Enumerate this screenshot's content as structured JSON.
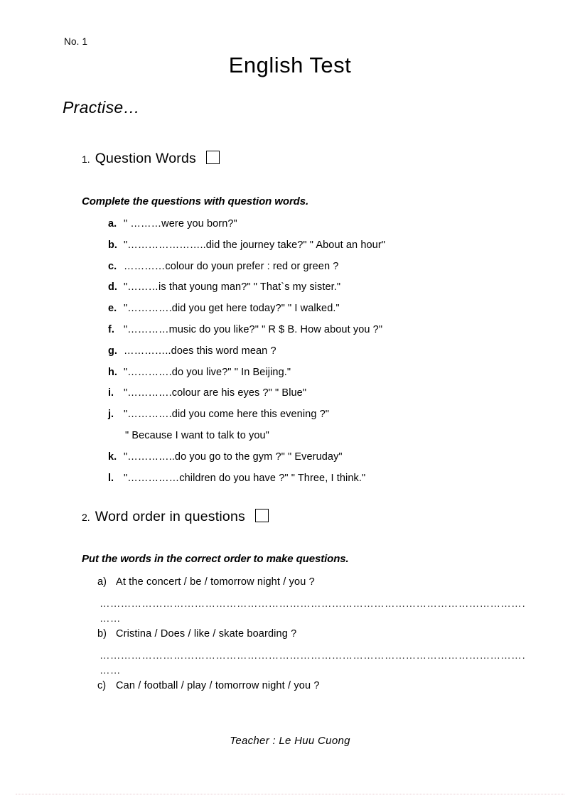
{
  "document": {
    "page_number_label": "No. 1",
    "title": "English Test",
    "subtitle": "Practise…",
    "footer": "Teacher : Le Huu Cuong"
  },
  "sections": [
    {
      "number": "1.",
      "title": "Question Words",
      "checkbox": "empty-checkbox",
      "instruction": "Complete the questions with question words.",
      "items": [
        {
          "marker": "a.",
          "text": "\" ………were you born?\""
        },
        {
          "marker": "b.",
          "text": "\"…………………..did the journey take?\" \" About an hour\""
        },
        {
          "marker": "c.",
          "text": "…………colour do youn prefer : red or green ?"
        },
        {
          "marker": "d.",
          "text": "\"………is that young man?\" \" That`s my sister.\""
        },
        {
          "marker": "e.",
          "text": "\"………….did you get here today?\" \" I walked.\""
        },
        {
          "marker": "f.",
          "text": "\"…………music do you like?\" \" R $ B. How about you ?\""
        },
        {
          "marker": "g.",
          "text": "…………..does this word mean ?"
        },
        {
          "marker": "h.",
          "text": "\"………….do you live?\" \" In Beijing.\""
        },
        {
          "marker": "i.",
          "text": "\"………….colour are his eyes ?\" \" Blue\""
        },
        {
          "marker": "j.",
          "text": "\"………….did you come here this evening ?\""
        },
        {
          "marker": "",
          "text": "\" Because I want to talk to you\"",
          "continuation": true
        },
        {
          "marker": "k.",
          "text": "\"…………..do you go to the gym ?\" \" Everuday\""
        },
        {
          "marker": "l.",
          "text": "\"……………children do you have ?\" \" Three, I think.\""
        }
      ]
    },
    {
      "number": "2.",
      "title": "Word order in questions",
      "checkbox": "empty-checkbox",
      "instruction": "Put the words in the correct order to make questions.",
      "items": [
        {
          "marker": "a)",
          "text": "At the concert / be / tomorrow night / you ?",
          "answer_line": true
        },
        {
          "marker": "b)",
          "text": "Cristina / Does / like / skate boarding ?",
          "answer_line": true
        },
        {
          "marker": "c)",
          "text": "Can / football / play / tomorrow night / you ?",
          "answer_line": false
        }
      ]
    }
  ],
  "answer_line": {
    "dots_long": "…………………………………………………………………………………………………………………………………………",
    "dots_short": "……"
  }
}
